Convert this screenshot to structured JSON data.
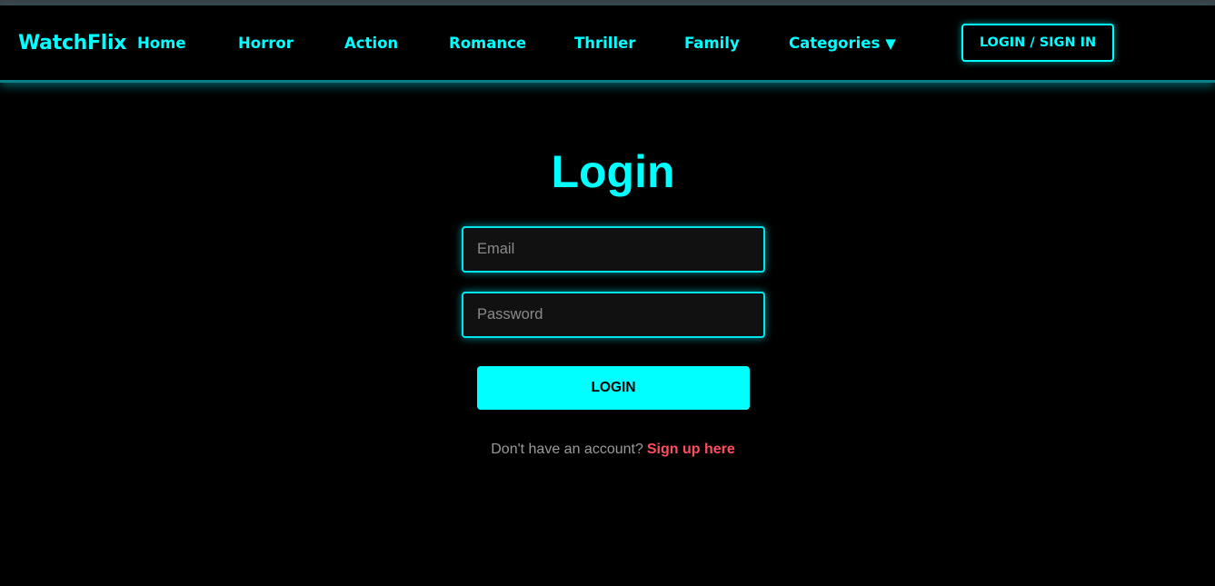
{
  "nav": {
    "brand": "WatchFlix",
    "links": [
      {
        "label": "Home"
      },
      {
        "label": "Horror"
      },
      {
        "label": "Action"
      },
      {
        "label": "Romance"
      },
      {
        "label": "Thriller"
      },
      {
        "label": "Family"
      },
      {
        "label": "Categories"
      }
    ],
    "categories_caret": "▼",
    "login_button": "LOGIN / SIGN IN"
  },
  "form": {
    "title": "Login",
    "email_placeholder": "Email",
    "email_value": "",
    "password_placeholder": "Password",
    "password_value": "",
    "submit_label": "LOGIN",
    "signup_prompt": "Don't have an account?",
    "signup_link": "Sign up here"
  },
  "colors": {
    "accent": "#00ffff",
    "background": "#000000",
    "input_background": "#111111",
    "signup_link": "#ff4d5e",
    "muted_text": "#9a9a9a"
  },
  "icons": {
    "categories_dropdown": "caret-down-icon"
  }
}
